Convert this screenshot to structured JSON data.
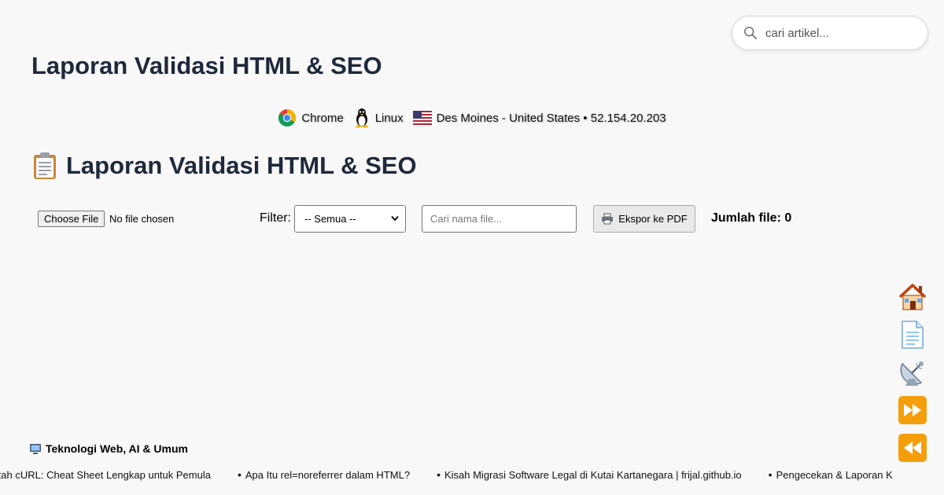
{
  "search": {
    "placeholder": "cari artikel..."
  },
  "site_title": "Laporan Validasi HTML & SEO",
  "visitor": {
    "browser": "Chrome",
    "os": "Linux",
    "location": "Des Moines - United States • 52.154.20.203"
  },
  "report_title": "Laporan Validasi HTML & SEO",
  "toolbar": {
    "file_button": "Choose File",
    "file_status": "No file chosen",
    "filter_label": "Filter:",
    "filter_selected": "-- Semua --",
    "name_placeholder": "Cari nama file...",
    "export_label": "Ekspor ke PDF",
    "count_label": "Jumlah file: 0"
  },
  "sidenav": [
    "home-icon",
    "document-icon",
    "satellite-icon",
    "fast-forward-icon",
    "rewind-icon"
  ],
  "ticker": {
    "heading": "Teknologi Web, AI & Umum",
    "items": [
      "erintah cURL: Cheat Sheet Lengkap untuk Pemula",
      "Apa Itu rel=noreferrer dalam HTML?",
      "Kisah Migrasi Software Legal di Kutai Kartanegara | frijal.github.io",
      "Pengecekan & Laporan K"
    ]
  },
  "colors": {
    "title": "#1e293b",
    "background": "#f8f8f9",
    "accent_orange": "#f59e0b"
  }
}
